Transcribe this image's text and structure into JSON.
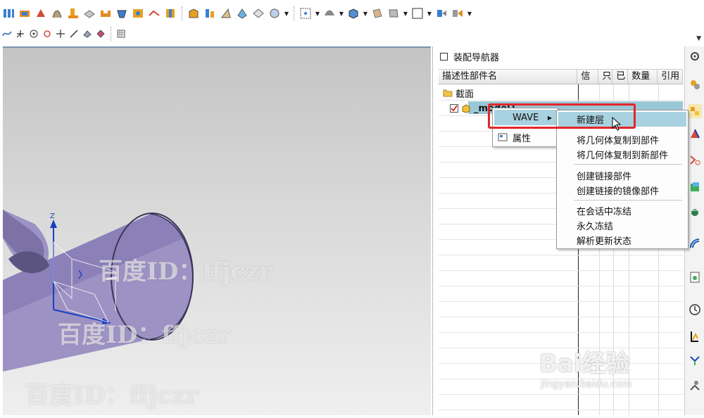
{
  "navigator": {
    "title": "装配导航器",
    "columns": [
      "描述性部件名",
      "信",
      "只",
      "已",
      "数量",
      "引用"
    ],
    "tree": [
      {
        "label": "截面"
      },
      {
        "label": "_model1"
      }
    ]
  },
  "context_menu": {
    "items": [
      {
        "label": "WAVE"
      },
      {
        "label": "属性"
      }
    ],
    "wave_submenu": [
      {
        "label": "新建层"
      },
      {
        "label": "将几何体复制到部件"
      },
      {
        "label": "将几何体复制到新部件"
      },
      {
        "label": "创建链接部件"
      },
      {
        "label": "创建链接的镜像部件"
      },
      {
        "label": "在会话中冻结"
      },
      {
        "label": "永久冻结"
      },
      {
        "label": "解析更新状态"
      }
    ]
  },
  "viewport": {
    "axis_label_z": "Z",
    "watermark": "百度ID：ffjczr"
  },
  "branding": {
    "baidu_text": "Bai经验",
    "baidu_url": "jingyan.baidu.com"
  },
  "colors": {
    "part_fill": "#9d92c4",
    "selection": "#a9d2e0",
    "highlight_box": "#e3262b"
  }
}
